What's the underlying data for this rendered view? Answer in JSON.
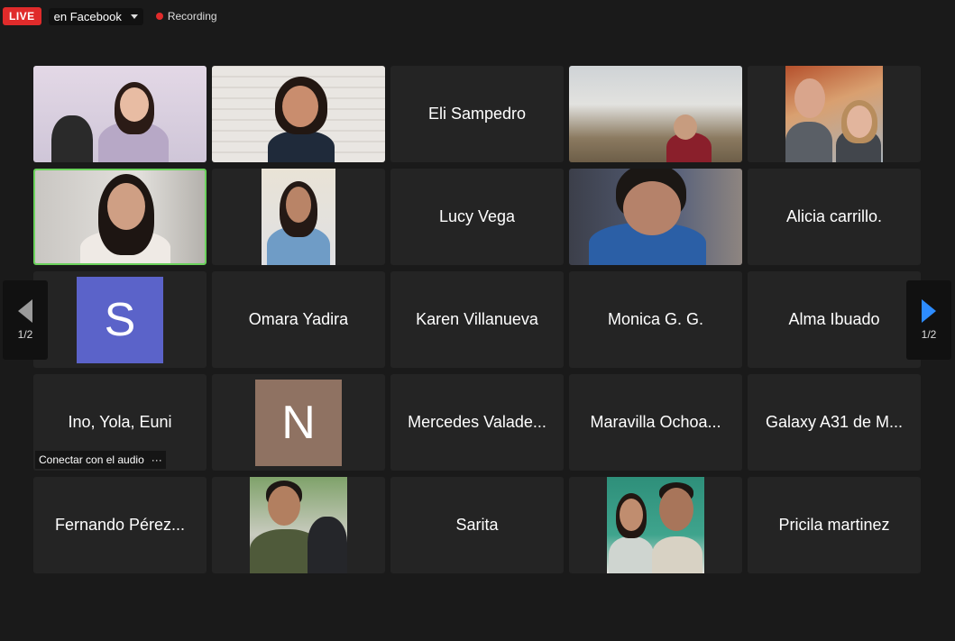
{
  "topbar": {
    "live_label": "LIVE",
    "stream_target": "en Facebook",
    "recording_label": "Recording"
  },
  "navigation": {
    "prev_page": "1/2",
    "next_page": "1/2"
  },
  "avatars": {
    "s": {
      "letter": "S",
      "color": "#5b63c9"
    },
    "n": {
      "letter": "N",
      "color": "#8f7262"
    }
  },
  "tiles": [
    {
      "name": "Eli Sampedro"
    },
    {
      "name": "Lucy Vega"
    },
    {
      "name": "Alicia carrillo."
    },
    {
      "name": "Omara Yadira"
    },
    {
      "name": "Karen Villanueva"
    },
    {
      "name": "Monica G. G."
    },
    {
      "name": "Alma Ibuado"
    },
    {
      "name": "Ino, Yola, Euni",
      "status": "Conectar con el audio",
      "menu": "···"
    },
    {
      "name": "Mercedes Valade..."
    },
    {
      "name": "Maravilla Ochoa..."
    },
    {
      "name": "Galaxy A31 de M..."
    },
    {
      "name": "Fernando Pérez..."
    },
    {
      "name": "Sarita"
    },
    {
      "name": "Pricila martinez"
    }
  ],
  "colors": {
    "live": "#e02b2b",
    "active_speaker_border": "#6bd25c",
    "next_arrow": "#2d8cff"
  }
}
